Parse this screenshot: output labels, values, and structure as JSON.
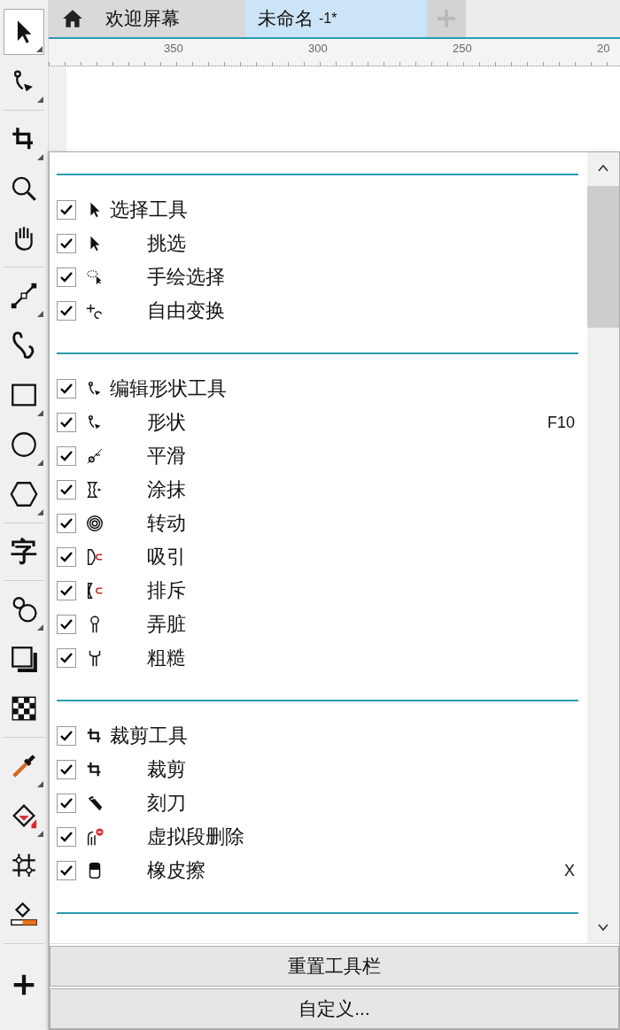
{
  "toolbox": {
    "groups": [
      [
        {
          "kind": "pick",
          "selected": true
        },
        {
          "kind": "shape",
          "selected": false
        }
      ],
      [
        {
          "kind": "crop",
          "selected": false
        },
        {
          "kind": "zoom",
          "selected": false
        },
        {
          "kind": "pan",
          "selected": false
        }
      ],
      [
        {
          "kind": "line",
          "selected": false
        },
        {
          "kind": "curve",
          "selected": false
        },
        {
          "kind": "rectangle",
          "selected": false
        },
        {
          "kind": "ellipse",
          "selected": false
        },
        {
          "kind": "polygon",
          "selected": false
        }
      ],
      [
        {
          "kind": "text",
          "glyph": "字",
          "selected": false
        }
      ],
      [
        {
          "kind": "blend",
          "selected": false
        },
        {
          "kind": "shadow",
          "selected": false
        },
        {
          "kind": "transparency",
          "selected": false
        }
      ],
      [
        {
          "kind": "eyedropper",
          "selected": false
        },
        {
          "kind": "fill",
          "selected": false
        },
        {
          "kind": "mesh",
          "selected": false
        },
        {
          "kind": "smartfill",
          "selected": false
        }
      ],
      [
        {
          "kind": "add",
          "selected": false
        }
      ]
    ]
  },
  "tabs": [
    {
      "label": "欢迎屏幕",
      "kind": "home",
      "selected": false
    },
    {
      "label": "未命名",
      "suffix": "-1*",
      "kind": "document",
      "selected": true
    }
  ],
  "ruler": {
    "labels": [
      "350",
      "300",
      "250",
      "20"
    ]
  },
  "panel": {
    "groups": [
      {
        "label": "选择工具",
        "kind": "pick",
        "checked": true,
        "children": [
          {
            "label": "挑选",
            "kind": "pick",
            "checked": true
          },
          {
            "label": "手绘选择",
            "kind": "freehand",
            "checked": true
          },
          {
            "label": "自由变换",
            "kind": "transform",
            "checked": true
          }
        ]
      },
      {
        "label": "编辑形状工具",
        "kind": "shape",
        "checked": true,
        "children": [
          {
            "label": "形状",
            "kind": "shape",
            "checked": true,
            "shortcut": "F10"
          },
          {
            "label": "平滑",
            "kind": "smooth",
            "checked": true
          },
          {
            "label": "涂抹",
            "kind": "smear",
            "checked": true
          },
          {
            "label": "转动",
            "kind": "twirl",
            "checked": true
          },
          {
            "label": "吸引",
            "kind": "attract",
            "checked": true
          },
          {
            "label": "排斥",
            "kind": "repel",
            "checked": true
          },
          {
            "label": "弄脏",
            "kind": "smudge",
            "checked": true
          },
          {
            "label": "粗糙",
            "kind": "roughen",
            "checked": true
          }
        ]
      },
      {
        "label": "裁剪工具",
        "kind": "crop",
        "checked": true,
        "children": [
          {
            "label": "裁剪",
            "kind": "crop",
            "checked": true
          },
          {
            "label": "刻刀",
            "kind": "knife",
            "checked": true
          },
          {
            "label": "虚拟段删除",
            "kind": "segdelete",
            "checked": true
          },
          {
            "label": "橡皮擦",
            "kind": "eraser",
            "checked": true,
            "shortcut": "X"
          }
        ]
      }
    ],
    "buttons": [
      "重置工具栏",
      "自定义..."
    ]
  }
}
